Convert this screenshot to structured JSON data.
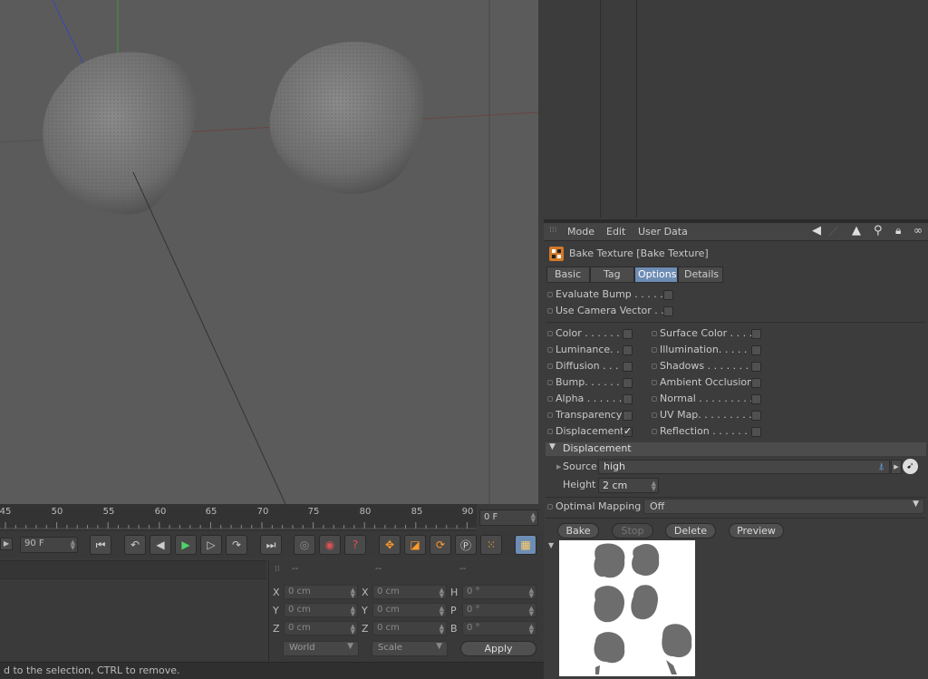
{
  "viewport": {},
  "timeline": {
    "ticks": [
      "45",
      "50",
      "55",
      "60",
      "65",
      "70",
      "75",
      "80",
      "85",
      "90"
    ],
    "current_frame": "0 F",
    "end_frame": "90 F"
  },
  "transport": {
    "icons": [
      "go-to-start-icon",
      "previous-key-icon",
      "previous-frame-icon",
      "play-icon",
      "next-frame-icon",
      "next-key-icon",
      "go-to-end-icon",
      "record-icon",
      "autokey-icon",
      "keyframe-selection-icon",
      "move-icon",
      "scale-icon",
      "rotate-icon",
      "parameter-icon",
      "pla-icon",
      "timeline-icon"
    ]
  },
  "coordinates": {
    "headers": [
      "--",
      "--",
      "--"
    ],
    "rows": [
      {
        "pos_label": "X",
        "pos": "0 cm",
        "size_label": "X",
        "size": "0 cm",
        "rot_label": "H",
        "rot": "0 °"
      },
      {
        "pos_label": "Y",
        "pos": "0 cm",
        "size_label": "Y",
        "size": "0 cm",
        "rot_label": "P",
        "rot": "0 °"
      },
      {
        "pos_label": "Z",
        "pos": "0 cm",
        "size_label": "Z",
        "size": "0 cm",
        "rot_label": "B",
        "rot": "0 °"
      }
    ],
    "mode_select": "World",
    "type_select": "Scale",
    "apply_label": "Apply"
  },
  "status": {
    "text": "d to the selection, CTRL to remove."
  },
  "attr": {
    "menu": {
      "mode": "Mode",
      "edit": "Edit",
      "user_data": "User Data"
    },
    "title": "Bake Texture [Bake Texture]",
    "tabs": [
      "Basic",
      "Tag",
      "Options",
      "Details"
    ],
    "active_tab": "Options",
    "evaluate_bump": "Evaluate Bump . . . . . .",
    "use_camera_vector": "Use Camera Vector . .",
    "left_channels": [
      {
        "label": "Color . . . . . . .",
        "checked": false
      },
      {
        "label": "Luminance. . .",
        "checked": false
      },
      {
        "label": "Diffusion . . . .",
        "checked": false
      },
      {
        "label": "Bump. . . . . . .",
        "checked": false
      },
      {
        "label": "Alpha . . . . . . .",
        "checked": false
      },
      {
        "label": "Transparency",
        "checked": false
      },
      {
        "label": "Displacement",
        "checked": true
      }
    ],
    "right_channels": [
      {
        "label": "Surface Color . . . .",
        "checked": false
      },
      {
        "label": "Illumination. . . . . .",
        "checked": false
      },
      {
        "label": "Shadows . . . . . . . . .",
        "checked": false
      },
      {
        "label": "Ambient Occlusion",
        "checked": false
      },
      {
        "label": "Normal . . . . . . . . . .",
        "checked": false
      },
      {
        "label": "UV Map. . . . . . . . .",
        "checked": false
      },
      {
        "label": "Reflection . . . . . . .",
        "checked": false
      }
    ],
    "displacement_section": "Displacement",
    "source_label": "Source",
    "source_value": "high",
    "height_label": "Height",
    "height_value": "2 cm",
    "optimal_mapping_label": "Optimal Mapping",
    "optimal_mapping_value": "Off",
    "buttons": {
      "bake": "Bake",
      "stop": "Stop",
      "delete": "Delete",
      "preview": "Preview"
    }
  }
}
